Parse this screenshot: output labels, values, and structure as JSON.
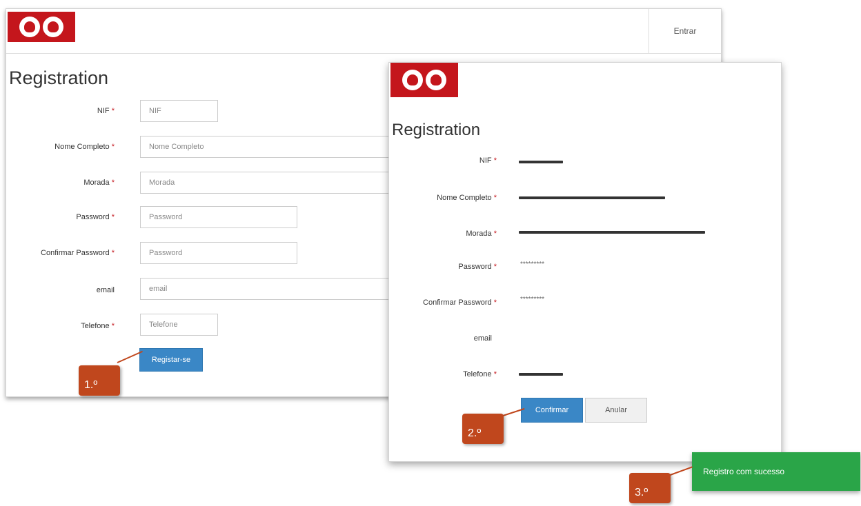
{
  "window1": {
    "nav": {
      "login_label": "Entrar"
    },
    "title": "Registration",
    "fields": [
      {
        "label": "NIF",
        "placeholder": "NIF"
      },
      {
        "label": "Nome Completo",
        "placeholder": "Nome Completo"
      },
      {
        "label": "Morada",
        "placeholder": "Morada"
      },
      {
        "label": "Password",
        "placeholder": "Password"
      },
      {
        "label": "Confirmar Password",
        "placeholder": "Password"
      },
      {
        "label": "email",
        "placeholder": "email"
      },
      {
        "label": "Telefone",
        "placeholder": "Telefone"
      }
    ],
    "required_mark": "*",
    "submit_label": "Registar-se"
  },
  "window2": {
    "title": "Registration",
    "fields": [
      {
        "label": "NIF"
      },
      {
        "label": "Nome Completo"
      },
      {
        "label": "Morada"
      },
      {
        "label": "Password",
        "value": "*********"
      },
      {
        "label": "Confirmar Password",
        "value": "*********"
      },
      {
        "label": "email"
      },
      {
        "label": "Telefone"
      }
    ],
    "required_mark": "*",
    "confirm_label": "Confirmar",
    "cancel_label": "Anular"
  },
  "steps": [
    "1.º",
    "2.º",
    "3.º"
  ],
  "toast": {
    "message": "Registro com sucesso",
    "color": "#2aa548"
  },
  "colors": {
    "brand_red": "#c4161c",
    "primary_blue": "#3a87c6",
    "callout": "#c0471d"
  },
  "icons": [
    "flame-icon",
    "fire-icon"
  ]
}
